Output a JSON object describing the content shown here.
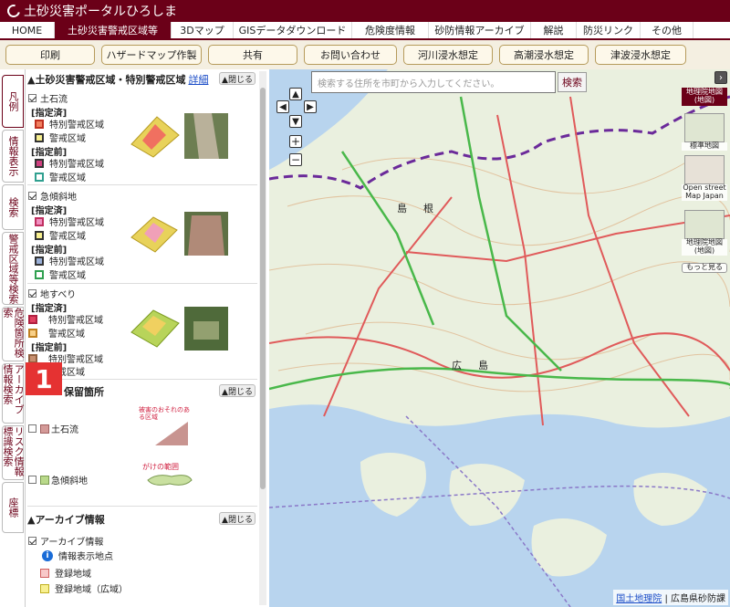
{
  "header": {
    "title": "土砂災害ポータルひろしま"
  },
  "nav": {
    "tabs": [
      {
        "label": "HOME",
        "active": false
      },
      {
        "label": "土砂災害警戒区域等",
        "active": true
      },
      {
        "label": "3Dマップ",
        "active": false
      },
      {
        "label": "GISデータダウンロード",
        "active": false
      },
      {
        "label": "危険度情報",
        "active": false
      },
      {
        "label": "砂防情報アーカイブ",
        "active": false
      },
      {
        "label": "解説",
        "active": false
      },
      {
        "label": "防災リンク",
        "active": false
      },
      {
        "label": "その他",
        "active": false
      }
    ]
  },
  "buttons": [
    "印刷",
    "ハザードマップ作製",
    "共有",
    "お問い合わせ",
    "河川浸水想定",
    "高潮浸水想定",
    "津波浸水想定"
  ],
  "vtabs": [
    "凡例",
    "情報表示",
    "検索",
    "警戒区域等検索",
    "危険箇所検索",
    "アーカイブ情報検索",
    "リスク情報標識検索",
    "座標"
  ],
  "badge": "1",
  "panel": {
    "sec1": {
      "title": "土砂災害警戒区域・特別警戒区域",
      "link": "詳細",
      "close": "▲閉じる"
    },
    "debris": {
      "label": "土石流"
    },
    "steep": {
      "label": "急傾斜地"
    },
    "landslide": {
      "label": "地すべり"
    },
    "designated": "[指定済]",
    "predesignated": "[指定前]",
    "special": "特別警戒区域",
    "caution": "警戒区域",
    "sec2": {
      "title": "保留箇所",
      "close": "▲閉じる"
    },
    "hold_debris": "土石流",
    "hold_steep": "急傾斜地",
    "diag1": "被害のおそれのある区域",
    "diag2": "がけの範囲",
    "sec3": {
      "title": "アーカイブ情報",
      "close": "▲閉じる"
    },
    "archive": "アーカイブ情報",
    "info_point": "情報表示地点",
    "reg_area": "登録地域",
    "reg_area_wide": "登録地域（広域）"
  },
  "map": {
    "search_placeholder": "検索する住所を市町から入力してください。",
    "search_btn": "検索",
    "layers": [
      "地理院地図(地図)",
      "標準地図",
      "Open street Map Japan",
      "地理院地図(地図)",
      "もっと見る"
    ],
    "place1": "島根",
    "place2": "広島",
    "credit_link": "国土地理院",
    "credit_text": "広島県砂防課"
  },
  "colors": {
    "brand": "#6b0018",
    "accent": "#e53232"
  }
}
